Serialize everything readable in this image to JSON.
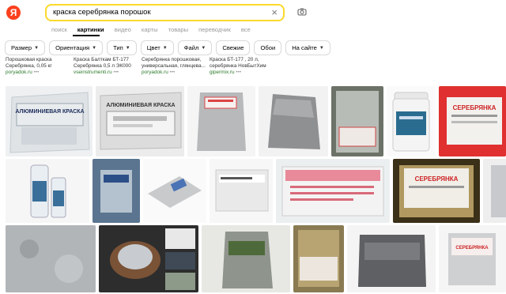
{
  "header": {
    "logo_letter": "Я",
    "search_query": "краска серебрянка порошок",
    "clear_symbol": "×"
  },
  "tabs": [
    "поиск",
    "картинки",
    "видео",
    "карты",
    "товары",
    "переводчик",
    "все"
  ],
  "active_tab": "картинки",
  "filters": [
    {
      "label": "Размер"
    },
    {
      "label": "Ориентация"
    },
    {
      "label": "Тип"
    },
    {
      "label": "Цвет"
    },
    {
      "label": "Файл"
    },
    {
      "label": "Свежие"
    },
    {
      "label": "Обои"
    },
    {
      "label": "На сайте"
    }
  ],
  "results": [
    {
      "line1": "Порошковая краска",
      "line2": "Серебрянка, 0,05 кг",
      "source": "poryadok.ru"
    },
    {
      "line1": "Краска Балткам БТ-177",
      "line2": "Серебрянка 0,5 л ЭК000",
      "source": "vseinstrumenti.ru"
    },
    {
      "line1": "Серебрянка порошковая,",
      "line2": "универсальная, глянцева...",
      "source": "poryadok.ru"
    },
    {
      "line1": "Краска БТ-177 , 20 л,",
      "line2": "серебрянка НовБытХим",
      "source": "gipermix.ru"
    }
  ],
  "dots": "•••",
  "image_labels": {
    "tile1": "АЛЮМИНИЕВАЯ КРАСКА",
    "tile2": "АЛЮМИНИЕВАЯ КРАСКА",
    "tile7": "СЕРЕБРЯНКА",
    "tile13": "СЕРЕБРЯНКА",
    "tile14": "СЕРЕБРЯНКА"
  }
}
